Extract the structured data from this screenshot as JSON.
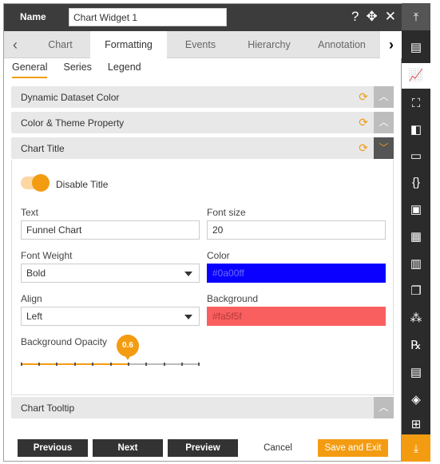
{
  "header": {
    "name_label": "Name",
    "name_value": "Chart Widget 1",
    "icons": [
      "help-icon",
      "move-icon",
      "close-icon"
    ]
  },
  "tabs": {
    "items": [
      "Chart",
      "Formatting",
      "Events",
      "Hierarchy",
      "Annotation"
    ],
    "active": "Formatting"
  },
  "subtabs": {
    "items": [
      "General",
      "Series",
      "Legend"
    ],
    "active": "General"
  },
  "sections": {
    "dynamic_dataset_color": "Dynamic Dataset Color",
    "color_theme_property": "Color & Theme Property",
    "chart_title": "Chart Title",
    "chart_tooltip": "Chart Tooltip"
  },
  "chart_title": {
    "disable_title_label": "Disable Title",
    "disable_title_on": true,
    "text_label": "Text",
    "text_value": "Funnel Chart",
    "font_size_label": "Font size",
    "font_size_value": "20",
    "font_weight_label": "Font Weight",
    "font_weight_value": "Bold",
    "color_label": "Color",
    "color_value": "#0a00ff",
    "align_label": "Align",
    "align_value": "Left",
    "background_label": "Background",
    "background_value": "#fa5f5f",
    "opacity_label": "Background Opacity",
    "opacity_value": "0.6"
  },
  "footer": {
    "previous": "Previous",
    "next": "Next",
    "preview": "Preview",
    "cancel": "Cancel",
    "save_exit": "Save and Exit"
  },
  "colors": {
    "accent": "#f39c12",
    "header_bg": "#3c3c3c",
    "title_color_swatch": "#0a00ff",
    "background_swatch": "#fa5f5f"
  },
  "sidebar": {
    "icons": [
      "collapse-top-icon",
      "table-icon",
      "chart-icon",
      "map-icon",
      "doc-chart-icon",
      "document-icon",
      "json-icon",
      "image-icon",
      "grid-chart-icon",
      "bar-report-icon",
      "copy-icon",
      "cubes-icon",
      "rx-icon",
      "report-icon",
      "layers-icon",
      "tree-icon",
      "collapse-bottom-icon"
    ],
    "active": "chart-icon"
  }
}
